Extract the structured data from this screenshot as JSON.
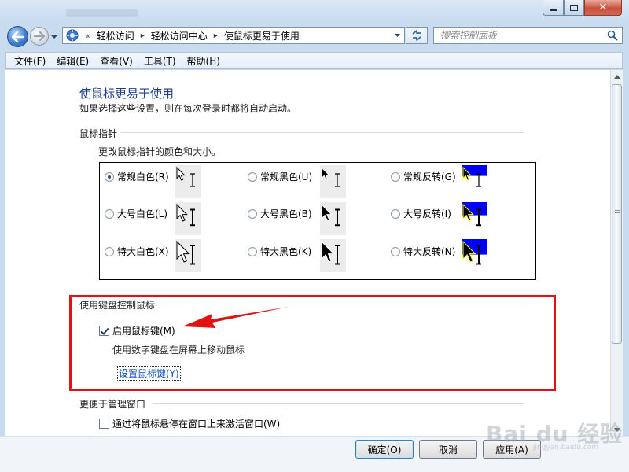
{
  "window": {
    "title_placeholder": ""
  },
  "nav": {
    "address_overflow": "«",
    "breadcrumbs": [
      "轻松访问",
      "轻松访问中心",
      "使鼠标更易于使用"
    ],
    "crumb_separator": "▸",
    "search_placeholder": "搜索控制面板"
  },
  "menu": [
    "文件(F)",
    "编辑(E)",
    "查看(V)",
    "工具(T)",
    "帮助(H)"
  ],
  "page": {
    "title": "使鼠标更易于使用",
    "description": "如果选择这些设置，则在每次登录时都将自动启动。"
  },
  "pointers": {
    "heading": "鼠标指针",
    "description": "更改鼠标指针的颜色和大小。",
    "selected_index": 0,
    "options": [
      {
        "label": "常规白色(R)",
        "scheme": "white",
        "size": "normal"
      },
      {
        "label": "常规黑色(U)",
        "scheme": "black",
        "size": "normal"
      },
      {
        "label": "常规反转(G)",
        "scheme": "inverted",
        "size": "normal"
      },
      {
        "label": "大号白色(L)",
        "scheme": "white",
        "size": "large"
      },
      {
        "label": "大号黑色(B)",
        "scheme": "black",
        "size": "large"
      },
      {
        "label": "大号反转(I)",
        "scheme": "inverted",
        "size": "large"
      },
      {
        "label": "特大白色(X)",
        "scheme": "white",
        "size": "xlarge"
      },
      {
        "label": "特大黑色(K)",
        "scheme": "black",
        "size": "xlarge"
      },
      {
        "label": "特大反转(N)",
        "scheme": "inverted",
        "size": "xlarge"
      }
    ]
  },
  "keyboard_control": {
    "heading": "使用键盘控制鼠标",
    "mouse_keys_label": "启用鼠标键(M)",
    "mouse_keys_checked": true,
    "mouse_keys_description": "使用数字键盘在屏幕上移动鼠标",
    "setup_link": "设置鼠标键(Y)"
  },
  "window_management": {
    "heading": "更便于管理窗口",
    "hover_activate_label": "通过将鼠标悬停在窗口上来激活窗口(W)",
    "hover_activate_checked": false
  },
  "buttons": {
    "ok": "确定(O)",
    "cancel": "取消",
    "apply": "应用(A)"
  },
  "watermark": {
    "text": "Bai du 经验",
    "sub": "jingyan.baidu.com"
  },
  "colors": {
    "title_blue": "#1e3f8a",
    "link_blue": "#0b4ec7",
    "highlight_red": "#e31212",
    "inverted_bg": "#0000ff",
    "inverted_fg": "#ffff00"
  }
}
